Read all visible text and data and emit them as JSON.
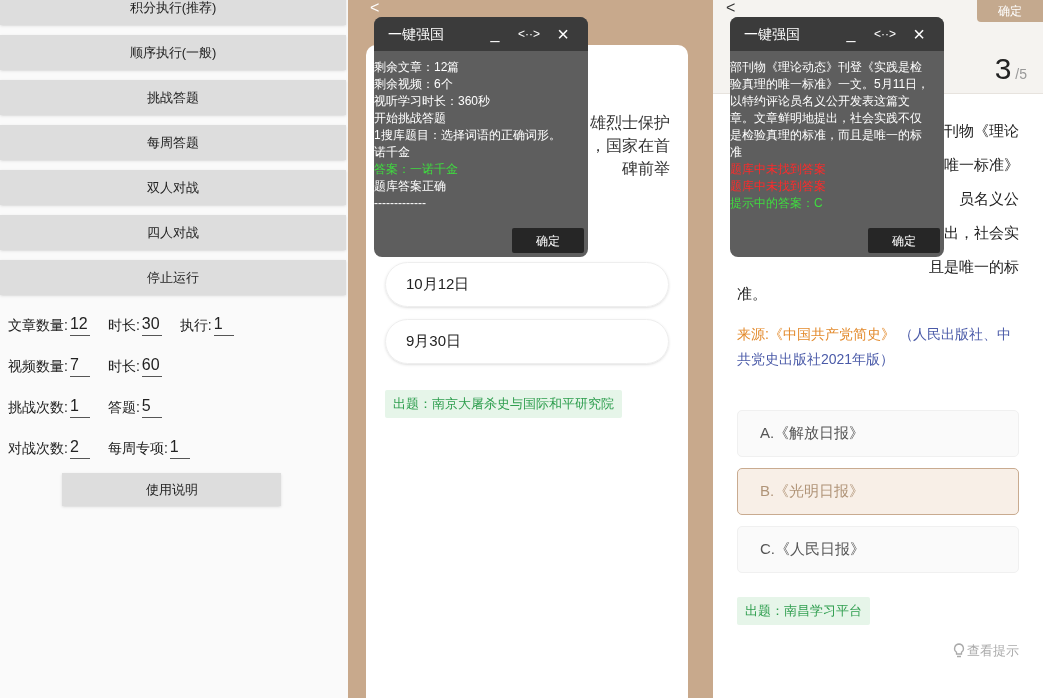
{
  "control_panel": {
    "buttons": [
      "积分执行(推荐)",
      "顺序执行(一般)",
      "挑战答题",
      "每周答题",
      "双人对战",
      "四人对战",
      "停止运行"
    ],
    "settings": [
      [
        {
          "label": "文章数量:",
          "value": "12"
        },
        {
          "label": "时长:",
          "value": "30"
        },
        {
          "label": "执行:",
          "value": "1"
        }
      ],
      [
        {
          "label": "视频数量:",
          "value": "7"
        },
        {
          "label": "时长:",
          "value": "60"
        }
      ],
      [
        {
          "label": "挑战次数:",
          "value": "1"
        },
        {
          "label": "答题:",
          "value": "5"
        }
      ],
      [
        {
          "label": "对战次数:",
          "value": "2"
        },
        {
          "label": "每周专项:",
          "value": "1"
        }
      ]
    ],
    "help_button": "使用说明"
  },
  "challenge_screen": {
    "back": "<",
    "question_visible": [
      "雄烈士保护",
      "，国家在首",
      "碑前举"
    ],
    "options": [
      "10月12日",
      "9月30日"
    ],
    "source_tag": "出题：南京大屠杀史与国际和平研究院",
    "overlay": {
      "title": "一键强国",
      "minimize": "_",
      "expand": "<··>",
      "close": "×",
      "log": [
        {
          "kind": "info",
          "text": "剩余文章：12篇"
        },
        {
          "kind": "info",
          "text": "剩余视频：6个"
        },
        {
          "kind": "info",
          "text": "视听学习时长：360秒"
        },
        {
          "kind": "info",
          "text": "开始挑战答题"
        },
        {
          "kind": "info",
          "text": "1搜库题目：选择词语的正确词形。"
        },
        {
          "kind": "info",
          "text": "诺千金"
        },
        {
          "kind": "success",
          "text": "答案：一诺千金"
        },
        {
          "kind": "info",
          "text": "题库答案正确"
        },
        {
          "kind": "info",
          "text": "-------------"
        }
      ],
      "confirm": "确定"
    }
  },
  "quiz_screen": {
    "back": "<",
    "confirm": "确定",
    "progress": "3",
    "total": "/5",
    "question_visible": [
      "刊物《理论",
      "唯一标准》",
      "员名义公",
      "出，社会实",
      "且是唯一的标"
    ],
    "question_end": "准。",
    "source_label": "来源:《中国共产党简史》",
    "source_detail": "（人民出版社、中共党史出版社2021年版）",
    "options": [
      {
        "text": "A.《解放日报》",
        "selected": false
      },
      {
        "text": "B.《光明日报》",
        "selected": true
      },
      {
        "text": "C.《人民日报》",
        "selected": false
      }
    ],
    "source_tag": "出题：南昌学习平台",
    "hint": "查看提示",
    "overlay": {
      "title": "一键强国",
      "minimize": "_",
      "expand": "<··>",
      "close": "×",
      "log": [
        {
          "kind": "info",
          "text": "部刊物《理论动态》刊登《实践是检"
        },
        {
          "kind": "info",
          "text": "验真理的唯一标准》一文。5月11日，"
        },
        {
          "kind": "info",
          "text": "以特约评论员名义公开发表这篇文"
        },
        {
          "kind": "info",
          "text": "章。文章鲜明地提出，社会实践不仅"
        },
        {
          "kind": "info",
          "text": "是检验真理的标准，而且是唯一的标"
        },
        {
          "kind": "info",
          "text": "准"
        },
        {
          "kind": "error",
          "text": "题库中未找到答案"
        },
        {
          "kind": "error",
          "text": "题库中未找到答案"
        },
        {
          "kind": "success",
          "text": "提示中的答案：C"
        }
      ],
      "confirm": "确定"
    }
  }
}
